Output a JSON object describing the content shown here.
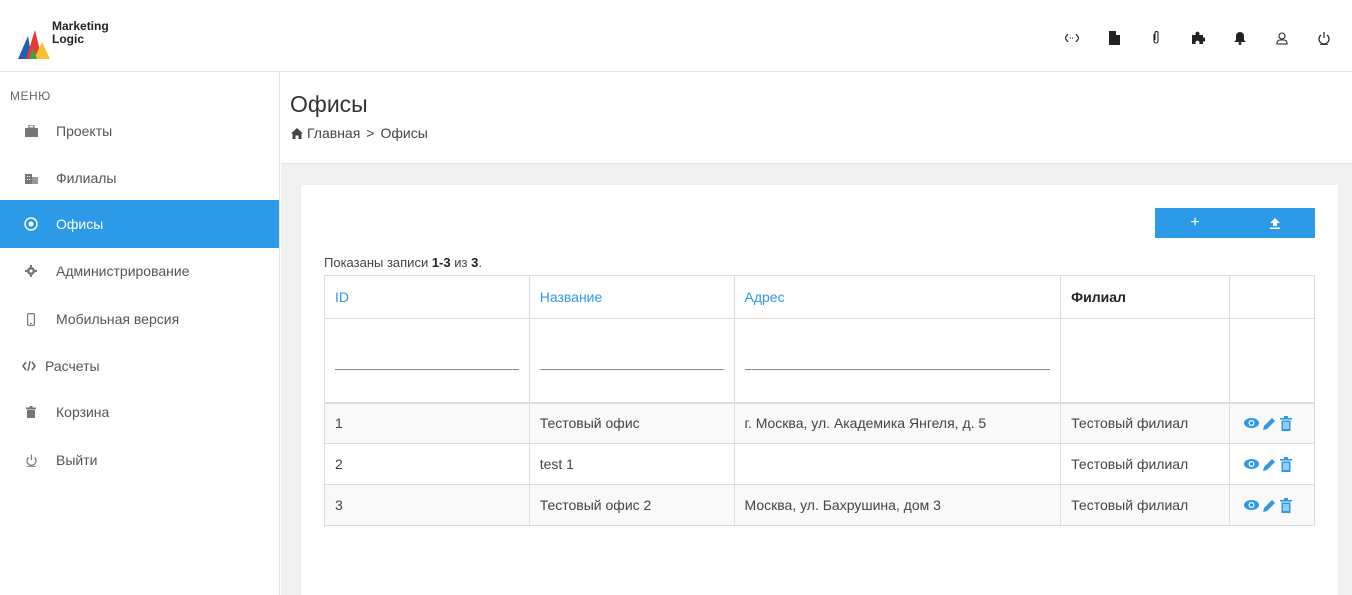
{
  "app": {
    "logo_line1": "Marketing",
    "logo_line2": "Logic",
    "accent": "#2d9ae8"
  },
  "top_icons": [
    "code-icon",
    "file-icon",
    "paperclip-icon",
    "puzzle-icon",
    "bell-icon",
    "user-icon",
    "power-icon"
  ],
  "sidebar": {
    "menu_label": "МЕНЮ",
    "items": [
      {
        "label": "Проекты",
        "icon": "briefcase-icon"
      },
      {
        "label": "Филиалы",
        "icon": "building-icon"
      },
      {
        "label": "Офисы",
        "icon": "target-icon",
        "active": true
      },
      {
        "label": "Администрирование",
        "icon": "gear-icon"
      },
      {
        "label": "Мобильная версия",
        "icon": "mobile-icon"
      },
      {
        "label": "Расчеты",
        "icon": "code-icon"
      },
      {
        "label": "Корзина",
        "icon": "trash-icon"
      },
      {
        "label": "Выйти",
        "icon": "power-icon"
      }
    ]
  },
  "page": {
    "title": "Офисы",
    "breadcrumb": {
      "home": "Главная",
      "sep": ">",
      "current": "Офисы"
    }
  },
  "toolbar": {
    "add_label": "+",
    "upload_icon": "upload-icon"
  },
  "summary": {
    "prefix": "Показаны записи ",
    "range": "1-3",
    "mid": " из ",
    "total": "3",
    "suffix": "."
  },
  "table": {
    "columns": [
      "ID",
      "Название",
      "Адрес",
      "Филиал",
      ""
    ],
    "rows": [
      {
        "id": "1",
        "name": "Тестовый офис",
        "address": "г. Москва, ул. Академика Янгеля, д. 5",
        "branch": "Тестовый филиал"
      },
      {
        "id": "2",
        "name": "test 1",
        "address": "",
        "branch": "Тестовый филиал"
      },
      {
        "id": "3",
        "name": "Тестовый офис 2",
        "address": "Москва, ул. Бахрушина, дом 3",
        "branch": "Тестовый филиал"
      }
    ]
  }
}
